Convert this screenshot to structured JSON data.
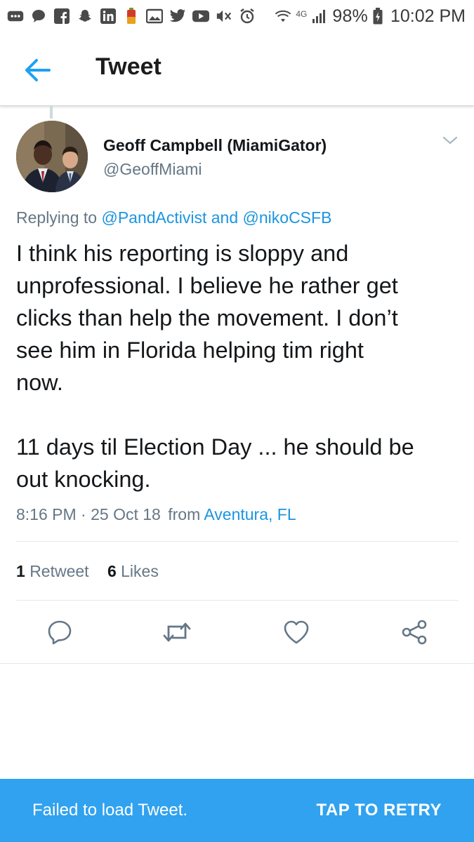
{
  "status_bar": {
    "network_label": "4G",
    "battery": "98%",
    "time": "10:02 PM",
    "icons": [
      "more-icon",
      "chat-icon",
      "facebook-icon",
      "snapchat-icon",
      "linkedin-icon",
      "battery-app-icon",
      "gallery-icon",
      "twitter-icon",
      "youtube-icon",
      "mute-icon",
      "alarm-icon",
      "wifi-icon",
      "signal-icon",
      "battery-icon"
    ]
  },
  "header": {
    "title": "Tweet",
    "back_icon": "back-arrow-icon"
  },
  "tweet": {
    "author_name": "Geoff Campbell (MiamiGator)",
    "author_handle": "@GeoffMiami",
    "replying_prefix": "Replying to ",
    "reply_mention_1": "@PandActivist",
    "reply_joiner": " and ",
    "reply_mention_2": "@nikoCSFB",
    "text": "I think his reporting is sloppy and\nunprofessional. I believe he rather get\nclicks than help the movement. I don’t\nsee him in Florida helping tim right\nnow.\n\n11 days til Election Day ... he should be\nout knocking.",
    "time": "8:16 PM",
    "separator": "·",
    "date": "25 Oct 18",
    "from_label": "from",
    "location": "Aventura, FL",
    "retweet_count": "1",
    "retweet_label": "Retweet",
    "like_count": "6",
    "like_label": "Likes"
  },
  "actions": [
    "reply-icon",
    "retweet-icon",
    "like-icon",
    "share-icon"
  ],
  "snackbar": {
    "message": "Failed to load Tweet.",
    "action": "TAP TO RETRY"
  },
  "colors": {
    "accent": "#1b95e0",
    "snackbar_bg": "#30a2ef",
    "secondary_text": "#657786",
    "primary_text": "#14171a"
  }
}
